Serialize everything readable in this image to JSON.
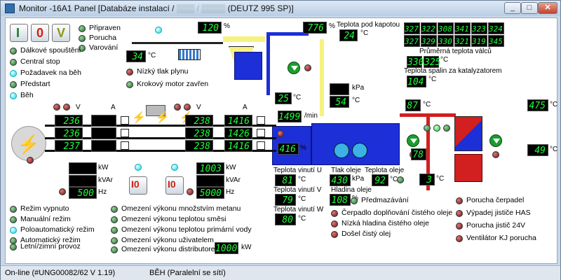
{
  "window": {
    "title": "Monitor -16A1 Panel [Databáze instalací / ",
    "title_blur": "▒▒▒ / ▒▒▒▒",
    "title_end": " (DEUTZ 995 SP)]",
    "min": "_",
    "max": "□",
    "close": "✕"
  },
  "controls": {
    "start": "I",
    "stop": "0",
    "ack": "V"
  },
  "gen_states": [
    "Připraven",
    "Porucha",
    "Varování"
  ],
  "remote": [
    "Dálkové spouštění",
    "Central stop",
    "Požadavek na běh",
    "Předstart",
    "Běh"
  ],
  "gas": {
    "low": "Nízký tlak plynu",
    "step": "Krokový motor zavřen"
  },
  "mix": {
    "pct": "120",
    "pct_unit": "%",
    "temp": "34",
    "temp_unit": "°C"
  },
  "valve2": {
    "pct": "776",
    "pct_unit": "%"
  },
  "cool_temp": {
    "v": "25",
    "u": "°C"
  },
  "kapot": {
    "label": "Teplota pod kapotou",
    "v": "24",
    "u": "°C"
  },
  "cyl": {
    "row1": [
      "327",
      "322",
      "308",
      "341",
      "323",
      "324"
    ],
    "row2": [
      "327",
      "329",
      "330",
      "321",
      "319",
      "345"
    ],
    "avg_label": "Průměrná teplota válců",
    "avg": [
      "330",
      "325"
    ],
    "avg_u": "°C",
    "cat_label": "Teplota spalin za katalyzatorem",
    "cat": "104",
    "cat_u": "°C"
  },
  "kpa": {
    "v": "",
    "u": "kPa",
    "t": "54",
    "tu": "°C"
  },
  "rpm": {
    "v": "1499",
    "u": "/min"
  },
  "gen_pct": {
    "v": "416",
    "u": "%"
  },
  "grid": {
    "v_unit": "V",
    "a_unit": "A",
    "v": [
      "236",
      "236",
      "237"
    ],
    "a": [
      "",
      "",
      ""
    ],
    "kw": "",
    "kw_u": "kW",
    "kvar": "",
    "kvar_u": "kVAr",
    "hz": "500",
    "hz_u": "Hz"
  },
  "gen": {
    "v_unit": "V",
    "a_unit": "A",
    "v": [
      "238",
      "238",
      "238"
    ],
    "a": [
      "1416",
      "1426",
      "1416"
    ],
    "kw": "1003",
    "kw_u": "kW",
    "kvar": "",
    "kvar_u": "kVAr",
    "hz": "5000",
    "hz_u": "Hz"
  },
  "wind": {
    "u_label": "Teplota vinutí U",
    "u": "81",
    "v_label": "Teplota vinutí V",
    "v": "79",
    "w_label": "Teplota vinutí W",
    "w": "80",
    "unit": "°C"
  },
  "oil": {
    "p_label": "Tlak oleje",
    "p": "430",
    "p_u": "kPa",
    "t_label": "Teplota oleje",
    "t": "92",
    "t_u": "°C",
    "lvl_label": "Hladina oleje",
    "lvl": "108",
    "lvl_u": "%"
  },
  "heat": {
    "t1": "87",
    "t2": "475",
    "t3": "78",
    "t4": "49",
    "t5": "3",
    "u": "°C"
  },
  "modes": [
    "Režim vypnuto",
    "Manuální režim",
    "Poloautomatický režim",
    "Automatický režim",
    "Letní/zimní provoz"
  ],
  "limits": [
    "Omezení výkonu množstvím metanu",
    "Omezení výkonu teplotou směsi",
    "Omezení výkonu teplotou primární vody",
    "Omezení výkonu uživatelem",
    "Omezení výkonu distributorem"
  ],
  "limit_kw": "1000",
  "limit_kw_u": "kW",
  "oil_alarms": [
    "Předmazávání",
    "Čerpadlo doplňování čistého oleje",
    "Nízká hladina čistého oleje",
    "Došel čistý olej"
  ],
  "faults": [
    "Porucha čerpadel",
    "Výpadej jističe HAS",
    "Porucha jistič 24V",
    "Ventilátor KJ porucha"
  ],
  "statusbar": {
    "left": "On-line (#UNG00082/62  V 1.19)",
    "right": "BĚH (Paralelní se sítí)"
  }
}
